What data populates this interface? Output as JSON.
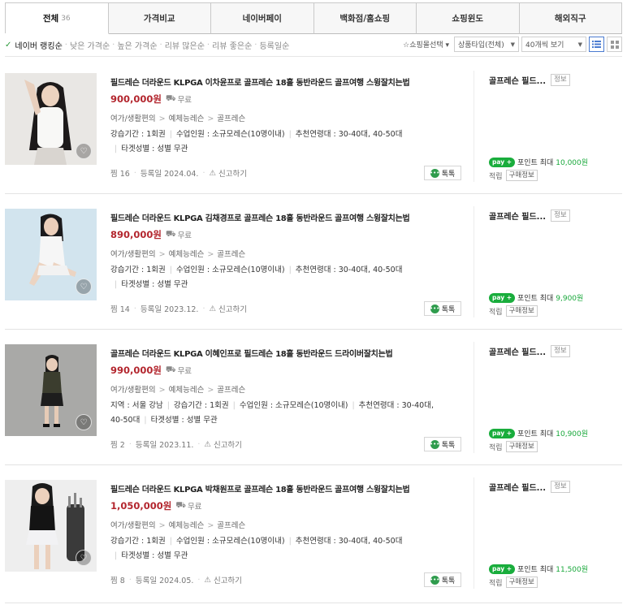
{
  "tabs": [
    {
      "label": "전체",
      "count": "36"
    },
    {
      "label": "가격비교",
      "count": ""
    },
    {
      "label": "네이버페이",
      "count": ""
    },
    {
      "label": "백화점/홈쇼핑",
      "count": ""
    },
    {
      "label": "쇼핑윈도",
      "count": ""
    },
    {
      "label": "해외직구",
      "count": ""
    }
  ],
  "sorts": [
    "네이버 랭킹순",
    "낮은 가격순",
    "높은 가격순",
    "리뷰 많은순",
    "리뷰 좋은순",
    "등록일순"
  ],
  "filters": {
    "service": "쇼핑몰선택",
    "product_type": "상품타입(전체)",
    "page_size": "40개씩 보기"
  },
  "colors": {
    "accent": "#2d9b3b",
    "price": "#b3262e",
    "npay": "#19ad3c"
  },
  "labels": {
    "talk": "톡톡",
    "report": "신고하기",
    "badge": "정보",
    "npay": "pay",
    "point_label": "포인트 최대",
    "accum": "적립",
    "buy_info": "구매정보",
    "free_shipping": "무료",
    "heart_icon": "♡"
  },
  "products": [
    {
      "title": "필드레슨 더라운드 KLPGA 이차윤프로 골프레슨 18홀 동반라운드 골프여행 스윙잘치는법",
      "price": "900,000원",
      "category": [
        "여가/생활편의",
        "예체능레슨",
        "골프레슨"
      ],
      "specs": [
        [
          "강습기간 : 1회권",
          "수업인원 : 소규모레슨(10명이내)",
          "추천연령대 : 30-40대, 40-50대"
        ],
        [
          "타겟성별 : 성별 무관"
        ]
      ],
      "zzim": "찜 16",
      "date": "등록일 2024.04.",
      "mall": "골프레슨 필드...",
      "points": "10,000원"
    },
    {
      "title": "필드레슨 더라운드 KLPGA 김채경프로 골프레슨 18홀 동반라운드 골프여행 스윙잘치는법",
      "price": "890,000원",
      "category": [
        "여가/생활편의",
        "예체능레슨",
        "골프레슨"
      ],
      "specs": [
        [
          "강습기간 : 1회권",
          "수업인원 : 소규모레슨(10명이내)",
          "추천연령대 : 30-40대, 40-50대"
        ],
        [
          "타겟성별 : 성별 무관"
        ]
      ],
      "zzim": "찜 14",
      "date": "등록일 2023.12.",
      "mall": "골프레슨 필드...",
      "points": "9,900원"
    },
    {
      "title": "골프레슨 더라운드 KLPGA 이혜인프로 필드레슨 18홀 동반라운드 드라이버잘치는법",
      "price": "990,000원",
      "category": [
        "여가/생활편의",
        "예체능레슨",
        "골프레슨"
      ],
      "specs": [
        [
          "지역 : 서울 강남",
          "강습기간 : 1회권",
          "수업인원 : 소규모레슨(10명이내)",
          "추천연령대 : 30-40대,"
        ],
        [
          "40-50대",
          "타겟성별 : 성별 무관"
        ]
      ],
      "zzim": "찜 2",
      "date": "등록일 2023.11.",
      "mall": "골프레슨 필드...",
      "points": "10,900원"
    },
    {
      "title": "필드레슨 더라운드 KLPGA 박채원프로 골프레슨 18홀 동반라운드 골프여행 스윙잘치는법",
      "price": "1,050,000원",
      "category": [
        "여가/생활편의",
        "예체능레슨",
        "골프레슨"
      ],
      "specs": [
        [
          "강습기간 : 1회권",
          "수업인원 : 소규모레슨(10명이내)",
          "추천연령대 : 30-40대, 40-50대"
        ],
        [
          "타겟성별 : 성별 무관"
        ]
      ],
      "zzim": "찜 8",
      "date": "등록일 2024.05.",
      "mall": "골프레슨 필드...",
      "points": "11,500원"
    }
  ]
}
